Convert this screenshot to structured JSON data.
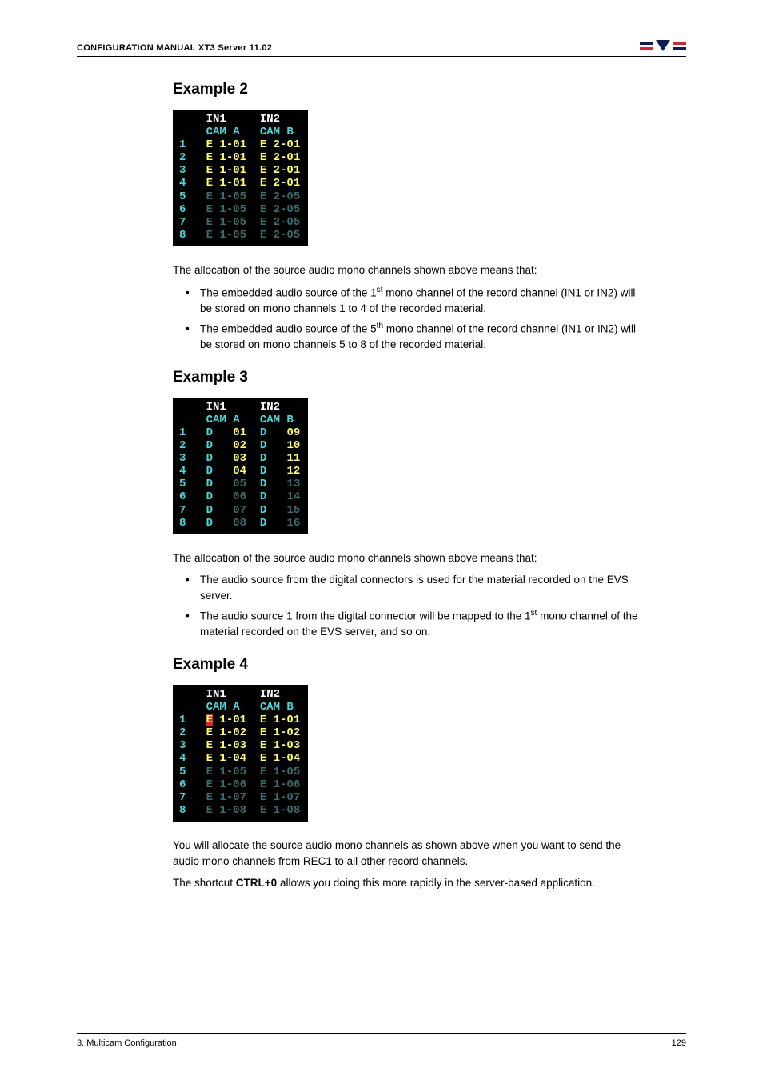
{
  "header": {
    "title": "CONFIGURATION MANUAL XT3 Server 11.02",
    "logo_alt": "EVS"
  },
  "example2": {
    "title": "Example 2",
    "table": {
      "col_headers_top": [
        "",
        "IN1",
        "IN2"
      ],
      "col_headers_sub": [
        "",
        "CAM A",
        "CAM B"
      ],
      "rows": [
        {
          "n": "1",
          "in1": "E 1-01",
          "in2": "E 2-01",
          "dim": false
        },
        {
          "n": "2",
          "in1": "E 1-01",
          "in2": "E 2-01",
          "dim": false
        },
        {
          "n": "3",
          "in1": "E 1-01",
          "in2": "E 2-01",
          "dim": false
        },
        {
          "n": "4",
          "in1": "E 1-01",
          "in2": "E 2-01",
          "dim": false
        },
        {
          "n": "5",
          "in1": "E 1-05",
          "in2": "E 2-05",
          "dim": true
        },
        {
          "n": "6",
          "in1": "E 1-05",
          "in2": "E 2-05",
          "dim": true
        },
        {
          "n": "7",
          "in1": "E 1-05",
          "in2": "E 2-05",
          "dim": true
        },
        {
          "n": "8",
          "in1": "E 1-05",
          "in2": "E 2-05",
          "dim": true
        }
      ]
    },
    "intro": "The allocation of the source audio mono channels shown above means that:",
    "bullets": [
      {
        "pre": "The embedded audio source of the 1",
        "sup": "st",
        "post": " mono channel of the record channel (IN1 or IN2) will be stored on mono channels 1 to 4 of the recorded material."
      },
      {
        "pre": "The embedded audio source of the 5",
        "sup": "th",
        "post": " mono channel of the record channel (IN1 or IN2) will be stored on mono channels 5 to 8 of the recorded material."
      }
    ]
  },
  "example3": {
    "title": "Example 3",
    "table": {
      "col_headers_top": [
        "",
        "IN1",
        "IN2"
      ],
      "col_headers_sub": [
        "",
        "CAM A",
        "CAM B"
      ],
      "rows": [
        {
          "n": "1",
          "in1_p": "D",
          "in1_v": "01",
          "in2_p": "D",
          "in2_v": "09",
          "dim": false
        },
        {
          "n": "2",
          "in1_p": "D",
          "in1_v": "02",
          "in2_p": "D",
          "in2_v": "10",
          "dim": false
        },
        {
          "n": "3",
          "in1_p": "D",
          "in1_v": "03",
          "in2_p": "D",
          "in2_v": "11",
          "dim": false
        },
        {
          "n": "4",
          "in1_p": "D",
          "in1_v": "04",
          "in2_p": "D",
          "in2_v": "12",
          "dim": false
        },
        {
          "n": "5",
          "in1_p": "D",
          "in1_v": "05",
          "in2_p": "D",
          "in2_v": "13",
          "dim": true
        },
        {
          "n": "6",
          "in1_p": "D",
          "in1_v": "06",
          "in2_p": "D",
          "in2_v": "14",
          "dim": true
        },
        {
          "n": "7",
          "in1_p": "D",
          "in1_v": "07",
          "in2_p": "D",
          "in2_v": "15",
          "dim": true
        },
        {
          "n": "8",
          "in1_p": "D",
          "in1_v": "08",
          "in2_p": "D",
          "in2_v": "16",
          "dim": true
        }
      ]
    },
    "intro": "The allocation of the source audio mono channels shown above means that:",
    "bullets": [
      {
        "pre": "The audio source from the digital connectors is used for the material recorded on the EVS server.",
        "sup": "",
        "post": ""
      },
      {
        "pre": "The audio source 1 from the digital connector will be mapped to the 1",
        "sup": "st",
        "post": " mono channel of the material recorded on the EVS server, and so on."
      }
    ]
  },
  "example4": {
    "title": "Example 4",
    "table": {
      "col_headers_top": [
        "",
        "IN1",
        "IN2"
      ],
      "col_headers_sub": [
        "",
        "CAM A",
        "CAM B"
      ],
      "rows": [
        {
          "n": "1",
          "in1_pre": "E",
          "in1_suf": " 1-01",
          "in2": "E 1-01",
          "dim": false,
          "sel": true
        },
        {
          "n": "2",
          "in1_pre": "",
          "in1_suf": "E 1-02",
          "in2": "E 1-02",
          "dim": false,
          "sel": false
        },
        {
          "n": "3",
          "in1_pre": "",
          "in1_suf": "E 1-03",
          "in2": "E 1-03",
          "dim": false,
          "sel": false
        },
        {
          "n": "4",
          "in1_pre": "",
          "in1_suf": "E 1-04",
          "in2": "E 1-04",
          "dim": false,
          "sel": false
        },
        {
          "n": "5",
          "in1_pre": "",
          "in1_suf": "E 1-05",
          "in2": "E 1-05",
          "dim": true,
          "sel": false
        },
        {
          "n": "6",
          "in1_pre": "",
          "in1_suf": "E 1-06",
          "in2": "E 1-06",
          "dim": true,
          "sel": false
        },
        {
          "n": "7",
          "in1_pre": "",
          "in1_suf": "E 1-07",
          "in2": "E 1-07",
          "dim": true,
          "sel": false
        },
        {
          "n": "8",
          "in1_pre": "",
          "in1_suf": "E 1-08",
          "in2": "E 1-08",
          "dim": true,
          "sel": false
        }
      ]
    },
    "para1": "You will allocate the source audio mono channels as shown above when you want to send the audio mono channels from REC1 to all other record channels.",
    "para2_pre": "The shortcut ",
    "para2_strong": "CTRL+0",
    "para2_post": " allows you doing this more rapidly in the server-based application."
  },
  "footer": {
    "left": "3. Multicam Configuration",
    "right": "129"
  }
}
